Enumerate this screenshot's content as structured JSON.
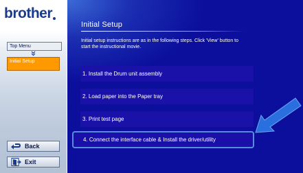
{
  "brand": {
    "name": "brother"
  },
  "sidebar": {
    "nav_top": "Top Menu",
    "nav_current": "Initial Setup",
    "back_label": "Back",
    "exit_label": "Exit"
  },
  "main": {
    "title": "Initial Setup",
    "intro": "Initial setup instructions are as in the following steps. Click 'View' button to start the instructional movie.",
    "steps": [
      {
        "label": "1. Install the Drum unit assembly"
      },
      {
        "label": "2. Load paper into the Paper tray"
      },
      {
        "label": "3. Print test page"
      },
      {
        "label": "4. Connect the interface cable & Install the driver/utility"
      }
    ]
  },
  "colors": {
    "brand_blue": "#1a3a8c",
    "main_bg": "#0b0f9c",
    "current_nav": "#ff9900",
    "pointer_arrow": "#2a6fe0"
  },
  "icons": {
    "back": "back-arrow-icon",
    "exit": "exit-door-icon",
    "pointer": "pointer-arrow-icon"
  }
}
